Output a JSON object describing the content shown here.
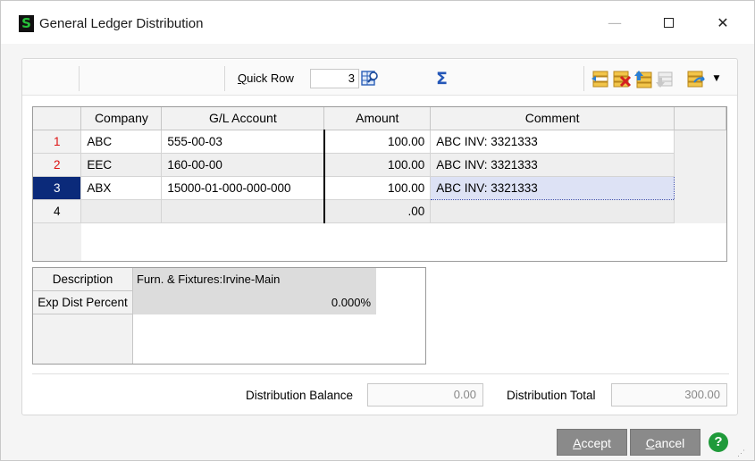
{
  "window": {
    "title": "General Ledger Distribution",
    "app_icon_glyph": "S",
    "controls": {
      "minimize": "—",
      "maximize": "",
      "close": "✕"
    }
  },
  "toolbar": {
    "quick_row_label_pre": "",
    "quick_row_label_u": "Q",
    "quick_row_label_post": "uick Row",
    "quick_row_value": "3",
    "sigma_glyph": "Σ",
    "dropdown_glyph": "▼"
  },
  "grid": {
    "columns": [
      "",
      "Company",
      "G/L Account",
      "Amount",
      "Comment"
    ],
    "rows": [
      {
        "num": "1",
        "company": "ABC",
        "account": "555-00-03",
        "amount": "100.00",
        "comment": "ABC  INV: 3321333"
      },
      {
        "num": "2",
        "company": "EEC",
        "account": "160-00-00",
        "amount": "100.00",
        "comment": "ABC  INV: 3321333"
      },
      {
        "num": "3",
        "company": "ABX",
        "account": "15000-01-000-000-000",
        "amount": "100.00",
        "comment": "ABC  INV: 3321333"
      },
      {
        "num": "4",
        "company": "",
        "account": "",
        "amount": ".00",
        "comment": ""
      }
    ]
  },
  "details": {
    "description_label": "Description",
    "description_value": "Furn. & Fixtures:Irvine-Main",
    "exp_dist_label": "Exp Dist Percent",
    "exp_dist_value": "0.000%"
  },
  "totals": {
    "balance_label": "Distribution Balance",
    "balance_value": "0.00",
    "total_label": "Distribution Total",
    "total_value": "300.00"
  },
  "buttons": {
    "accept_u": "A",
    "accept_rest": "ccept",
    "cancel_u": "C",
    "cancel_rest": "ancel",
    "help": "?"
  },
  "colors": {
    "accent_selected_row": "#0b2a7a",
    "row_number_red": "#d11111",
    "help_green": "#1f9a3a",
    "button_gray": "#8a8a8a"
  }
}
